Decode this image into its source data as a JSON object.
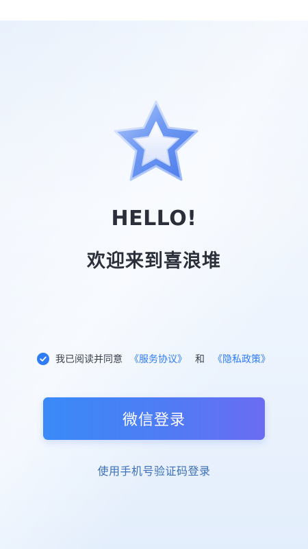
{
  "header": {
    "hello": "HELLO!",
    "welcome": "欢迎来到喜浪堆"
  },
  "illustration": {
    "icon": "star-icon",
    "colors": {
      "outer": "#5b8cf0",
      "inner": "#e6ecfb"
    }
  },
  "agreement": {
    "checked": true,
    "prefix": "我已阅读并同意",
    "service_link": "《服务协议》",
    "conjunction": "和",
    "privacy_link": "《隐私政策》"
  },
  "actions": {
    "wechat_login": "微信登录",
    "phone_login": "使用手机号验证码登录"
  },
  "theme": {
    "accent": "#2f7cf6",
    "button_gradient_start": "#3a8af8",
    "button_gradient_end": "#6a6cf2"
  }
}
